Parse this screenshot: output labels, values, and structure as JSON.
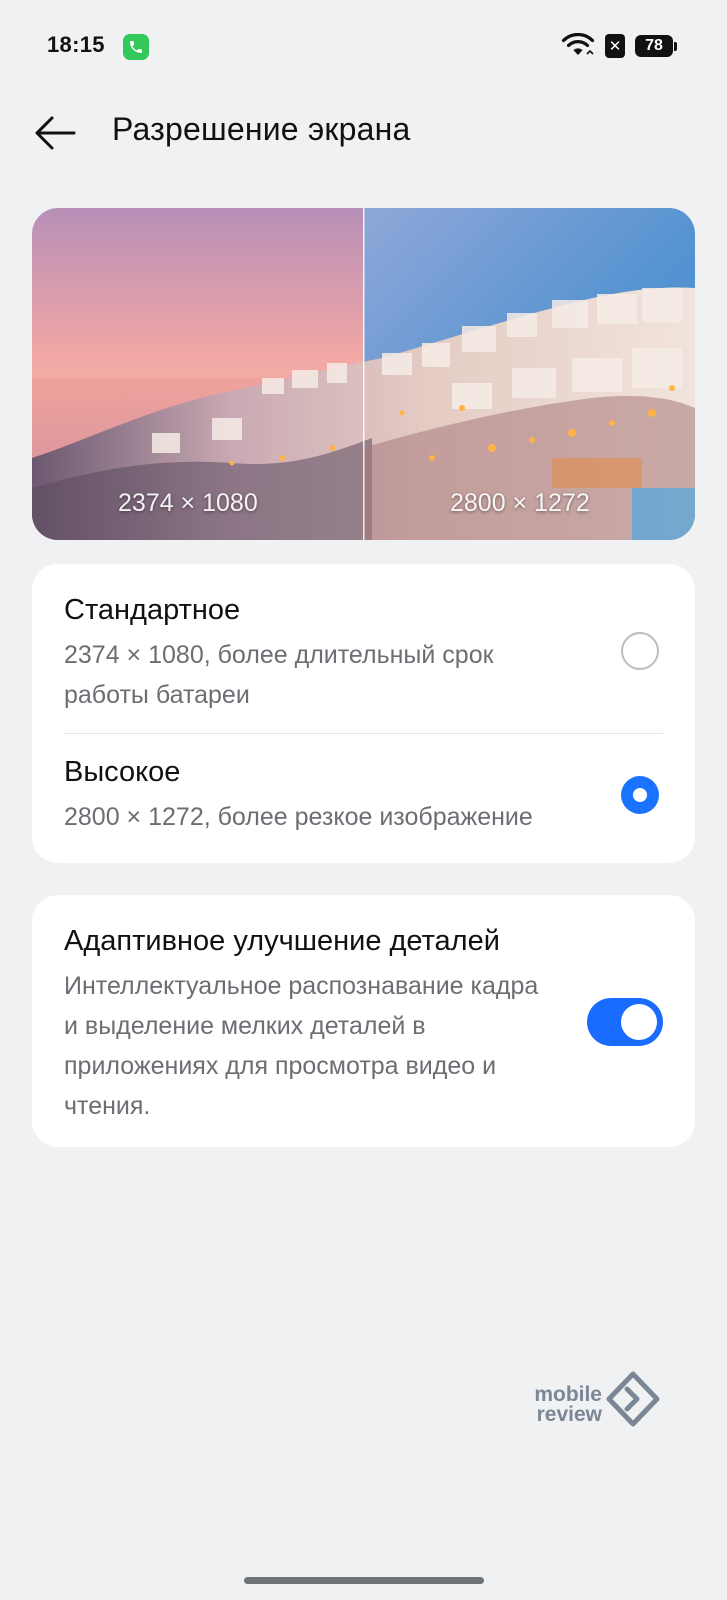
{
  "status_bar": {
    "time": "18:15",
    "battery_level": "78",
    "sim_icon": "sim-off-icon",
    "call_icon": "phone-call-icon",
    "wifi_icon": "wifi-icon"
  },
  "header": {
    "back_icon": "arrow-left-icon",
    "title": "Разрешение экрана"
  },
  "preview": {
    "left_label": "2374 × 1080",
    "right_label": "2800 × 1272"
  },
  "resolution_options": [
    {
      "title": "Стандартное",
      "description": "2374 × 1080, более длительный срок работы батареи",
      "selected": false
    },
    {
      "title": "Высокое",
      "description": "2800 × 1272, более резкое изображение",
      "selected": true
    }
  ],
  "adaptive": {
    "title": "Адаптивное улучшение деталей",
    "description": "Интеллектуальное распознавание кадра и выделение мелких деталей в приложениях для просмотра видео и чтения.",
    "enabled": true
  },
  "watermark": {
    "line1": "mobile",
    "line2": "review"
  },
  "colors": {
    "accent": "#1a6cff",
    "background": "#f0f1f3",
    "card": "#ffffff",
    "secondary_text": "#6b6e73"
  }
}
